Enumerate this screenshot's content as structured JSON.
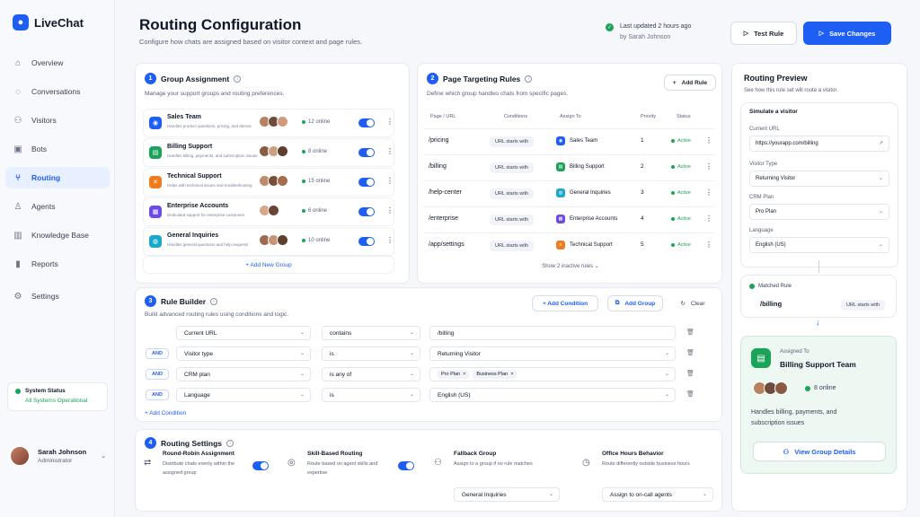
{
  "app": {
    "name": "LiveChat"
  },
  "nav": [
    {
      "label": "Overview",
      "icon": "home-icon"
    },
    {
      "label": "Conversations",
      "icon": "chat-icon"
    },
    {
      "label": "Visitors",
      "icon": "users-icon"
    },
    {
      "label": "Bots",
      "icon": "bot-icon"
    },
    {
      "label": "Routing",
      "icon": "routing-icon",
      "active": true
    },
    {
      "label": "Agents",
      "icon": "agent-icon"
    },
    {
      "label": "Knowledge Base",
      "icon": "book-icon"
    },
    {
      "label": "Reports",
      "icon": "chart-icon"
    },
    {
      "label": "Settings",
      "icon": "gear-icon"
    }
  ],
  "system_status": {
    "title": "System Status",
    "value": "All Systems Operational"
  },
  "user": {
    "name": "Sarah Johnson",
    "role": "Administrator"
  },
  "header": {
    "title": "Routing Configuration",
    "subtitle": "Configure how chats are assigned based on visitor context and page rules.",
    "updated": "Last updated 2 hours ago",
    "updated_by": "by Sarah Johnson",
    "test_label": "Test Rule",
    "save_label": "Save Changes"
  },
  "group_assignment": {
    "step": "1",
    "title": "Group Assignment",
    "subtitle": "Manage your support groups and routing preferences.",
    "groups": [
      {
        "name": "Sales Team",
        "desc": "Handles product questions, pricing, and demos",
        "online": "12 online",
        "color": "#1e5ef3"
      },
      {
        "name": "Billing Support",
        "desc": "Handles billing, payments, and subscription issues",
        "online": "8 online",
        "color": "#1ca35a"
      },
      {
        "name": "Technical Support",
        "desc": "Helps with technical issues and troubleshooting",
        "online": "15 online",
        "color": "#f07b1a"
      },
      {
        "name": "Enterprise Accounts",
        "desc": "Dedicated support for enterprise customers",
        "online": "6 online",
        "color": "#6d4ae8"
      },
      {
        "name": "General Inquiries",
        "desc": "Handles general questions and help requests",
        "online": "10 online",
        "color": "#19a8c9"
      }
    ],
    "add_label": "+ Add New Group"
  },
  "page_targeting": {
    "step": "2",
    "title": "Page Targeting Rules",
    "subtitle": "Define which group handles chats from specific pages.",
    "add_label": "Add Rule",
    "headers": [
      "Page / URL",
      "Conditions",
      "Assign To",
      "Priority",
      "Status"
    ],
    "rows": [
      {
        "path": "/pricing",
        "cond": "URL starts with",
        "group": "Sales Team",
        "priority": "1",
        "status": "Active",
        "color": "#1e5ef3"
      },
      {
        "path": "/billing",
        "cond": "URL starts with",
        "group": "Billing Support",
        "priority": "2",
        "status": "Active",
        "color": "#1ca35a"
      },
      {
        "path": "/help-center",
        "cond": "URL starts with",
        "group": "General Inquiries",
        "priority": "3",
        "status": "Active",
        "color": "#19a8c9"
      },
      {
        "path": "/enterprise",
        "cond": "URL starts with",
        "group": "Enterprise Accounts",
        "priority": "4",
        "status": "Active",
        "color": "#6d4ae8"
      },
      {
        "path": "/app/settings",
        "cond": "URL starts with",
        "group": "Technical Support",
        "priority": "5",
        "status": "Active",
        "color": "#f07b1a"
      }
    ],
    "show_inactive": "Show 2 inactive rules"
  },
  "rule_builder": {
    "step": "3",
    "title": "Rule Builder",
    "subtitle": "Build advanced routing rules using conditions and logic.",
    "add_condition_label": "+ Add Condition",
    "add_group_label": "Add Group",
    "clear_label": "Clear",
    "and_label": "AND",
    "conditions": [
      {
        "field": "Current URL",
        "op": "contains",
        "value": "/billing"
      },
      {
        "field": "Visitor type",
        "op": "is",
        "value": "Returning Visitor"
      },
      {
        "field": "CRM plan",
        "op": "is any of",
        "tags": [
          "Pro Plan",
          "Business Plan"
        ]
      },
      {
        "field": "Language",
        "op": "is",
        "value": "English (US)"
      }
    ],
    "footer_add": "+ Add Condition"
  },
  "routing_settings": {
    "step": "4",
    "title": "Routing Settings",
    "items": [
      {
        "title": "Round-Robin Assignment",
        "desc": "Distribute chats evenly within the assigned group"
      },
      {
        "title": "Skill-Based Routing",
        "desc": "Route based on agent skills and expertise"
      },
      {
        "title": "Fallback Group",
        "desc": "Assign to a group if no rule matches",
        "select": "General Inquiries"
      },
      {
        "title": "Office Hours Behavior",
        "desc": "Route differently outside business hours",
        "select": "Assign to on-call agents"
      }
    ]
  },
  "preview": {
    "title": "Routing Preview",
    "subtitle": "See how this rule set will route a visitor.",
    "simulate": "Simulate a visitor",
    "url_label": "Current URL",
    "url_value": "https://yourapp.com/billing",
    "visitor_label": "Visitor Type",
    "visitor_value": "Returning Visitor",
    "crm_label": "CRM Plan",
    "crm_value": "Pro Plan",
    "lang_label": "Language",
    "lang_value": "English (US)",
    "matched_label": "Matched Rule",
    "matched_path": "/billing",
    "matched_cond": "URL starts with",
    "assigned_label": "Assigned To",
    "assigned_team": "Billing Support Team",
    "assigned_online": "8 online",
    "assigned_desc": "Handles billing, payments, and subscription issues",
    "details_label": "View Group Details"
  }
}
